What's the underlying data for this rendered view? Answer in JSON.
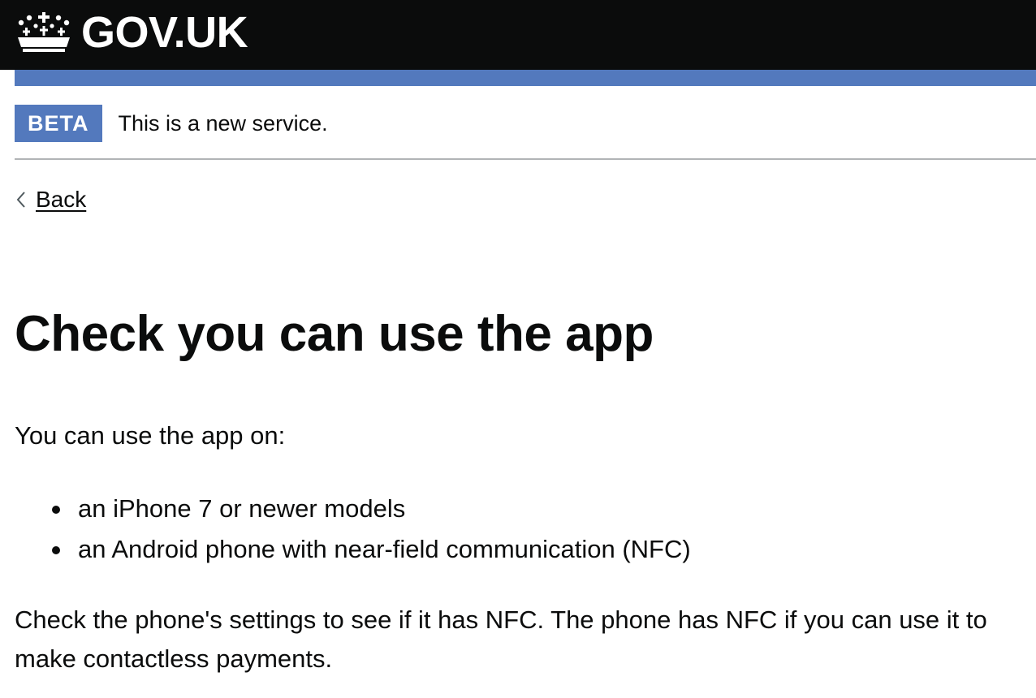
{
  "header": {
    "logotype": "GOV.UK",
    "logo_icon": "crown-icon",
    "background_color": "#0b0c0c",
    "accent_bar_color": "#5379bd"
  },
  "phase_banner": {
    "tag": "BETA",
    "text": "This is a new service.",
    "tag_color": "#5379bd"
  },
  "back_link": {
    "icon": "chevron-left-icon",
    "label": "Back"
  },
  "main": {
    "title": "Check you can use the app",
    "intro": "You can use the app on:",
    "bullets": [
      "an iPhone 7 or newer models",
      "an Android phone with near-field communication (NFC)"
    ],
    "nfc_paragraph": "Check the phone's settings to see if it has NFC. The phone has NFC if you can use it to make contactless payments."
  }
}
